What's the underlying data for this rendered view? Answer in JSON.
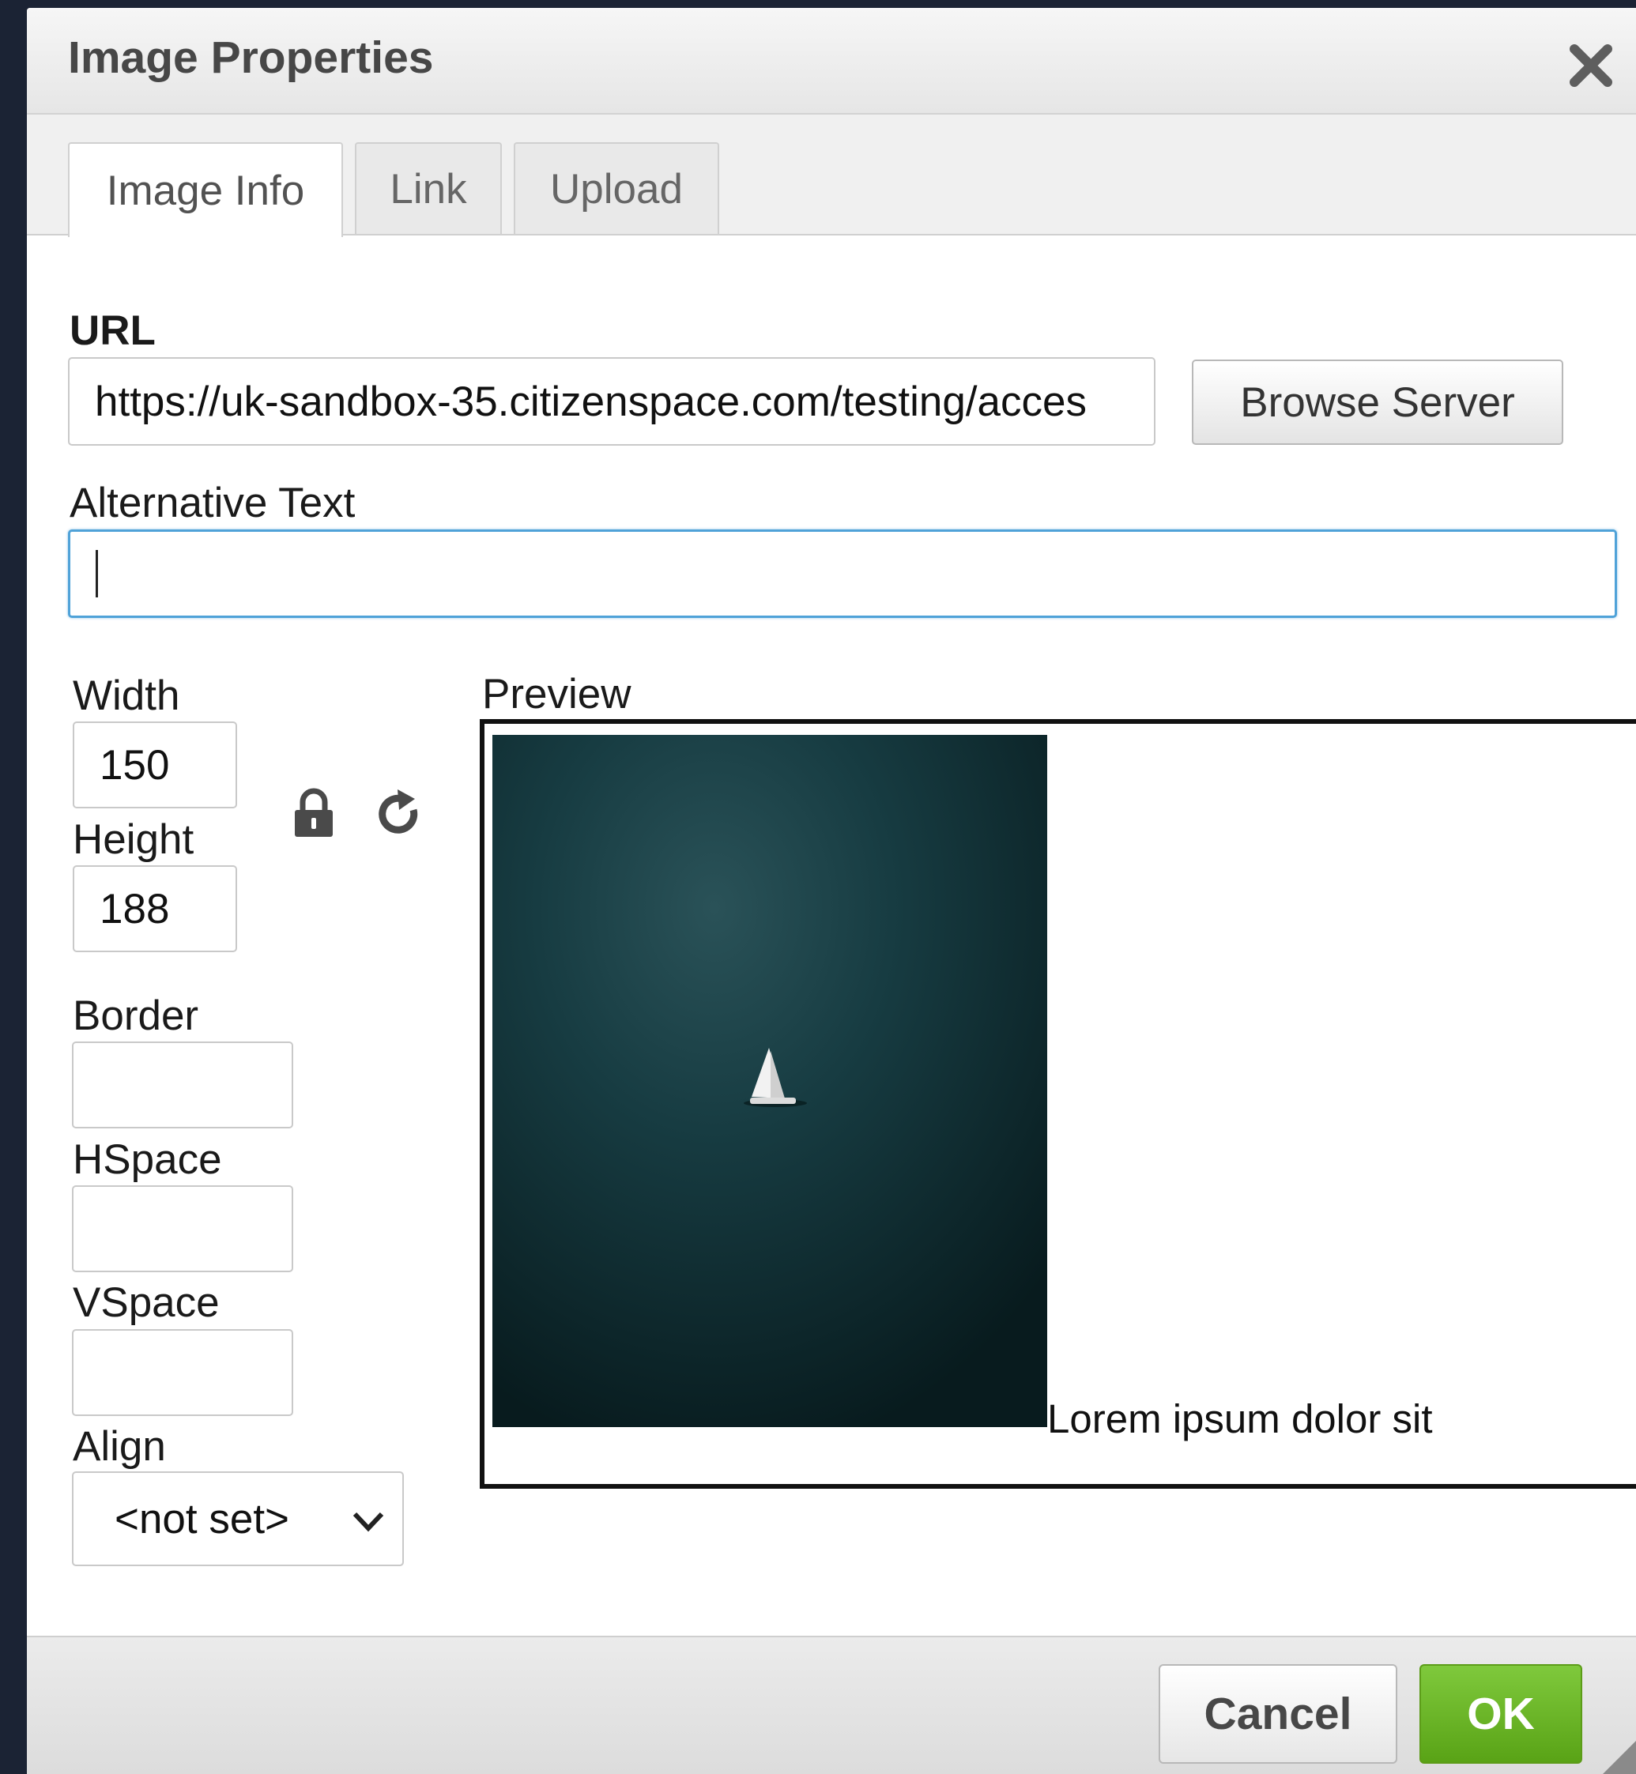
{
  "dialog": {
    "title": "Image Properties",
    "close_icon": "close-icon"
  },
  "tabs": [
    {
      "label": "Image Info",
      "active": true
    },
    {
      "label": "Link",
      "active": false
    },
    {
      "label": "Upload",
      "active": false
    }
  ],
  "url": {
    "label": "URL",
    "value": "https://uk-sandbox-35.citizenspace.com/testing/acces",
    "browse_label": "Browse Server"
  },
  "alt_text": {
    "label": "Alternative Text",
    "value": ""
  },
  "width": {
    "label": "Width",
    "value": "150"
  },
  "height": {
    "label": "Height",
    "value": "188"
  },
  "lock_icon": "lock-icon",
  "reset_icon": "reset-size-icon",
  "border": {
    "label": "Border",
    "value": ""
  },
  "hspace": {
    "label": "HSpace",
    "value": ""
  },
  "vspace": {
    "label": "VSpace",
    "value": ""
  },
  "align": {
    "label": "Align",
    "value": "<not set>"
  },
  "preview": {
    "label": "Preview",
    "text": "Lorem ipsum dolor sit"
  },
  "footer": {
    "cancel_label": "Cancel",
    "ok_label": "OK"
  },
  "colors": {
    "ok_green": "#6bb82a",
    "focus_blue": "#4fa2d8",
    "preview_water": "#163a40"
  }
}
